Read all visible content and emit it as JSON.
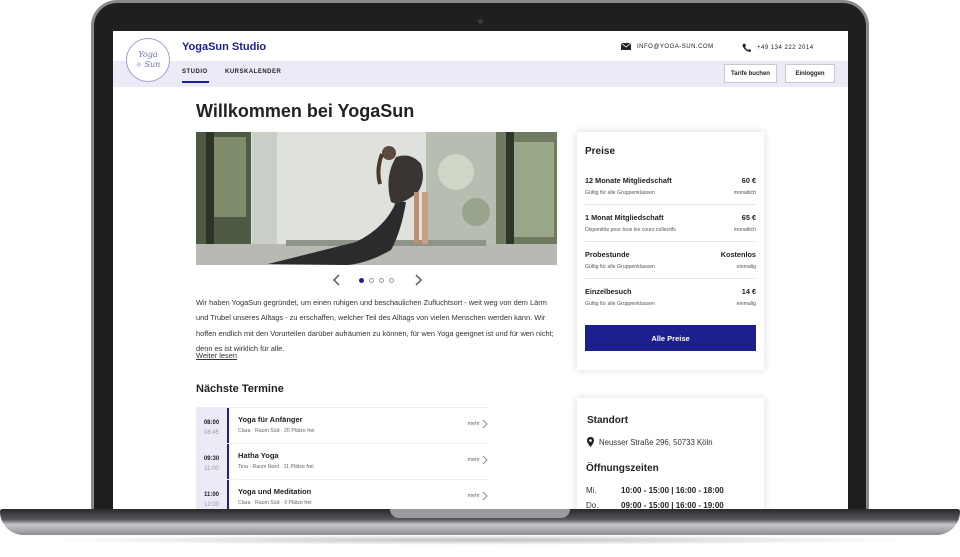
{
  "header": {
    "logo_text_line1": "Yoga",
    "logo_text_line2": "Sun",
    "brand": "YogaSun Studio",
    "email": "INFO@YOGA-SUN.COM",
    "phone": "+49 134 222 2014"
  },
  "nav": {
    "items": [
      {
        "label": "STUDIO",
        "active": true
      },
      {
        "label": "KURSKALENDER",
        "active": false
      }
    ],
    "buttons": {
      "book": "Tarife buchen",
      "login": "Einloggen"
    }
  },
  "main": {
    "title": "Willkommen bei  YogaSun",
    "carousel": {
      "slides": 4,
      "active": 1
    },
    "intro": "Wir haben YogaSun gegründet, um einen ruhigen und beschaulichen Zufluchtsort - weit weg von dem Lärm und Trubel unseres Alltags - zu erschaffen, welcher Teil des Alltags von vielen Menschen werden kann. Wir hoffen endlich mit den Vorurteilen darüber aufräumen zu können, für wen Yoga geeignet ist und für wen nicht; denn es ist wirklich für alle.",
    "read_more": "Weiter lesen"
  },
  "events": {
    "title": "Nächste Termine",
    "more_label": "mehr",
    "items": [
      {
        "start": "08:00",
        "end": "08:45",
        "name": "Yoga für Anfänger",
        "meta": "Clara · Raum Süd · 20 Plätze frei"
      },
      {
        "start": "09:30",
        "end": "11:00",
        "name": "Hatha Yoga",
        "meta": "Tina · Raum Nord · 11 Plätze frei"
      },
      {
        "start": "11:00",
        "end": "12:00",
        "name": "Yoga und Meditation",
        "meta": "Clara · Raum Süd · 9 Plätze frei"
      }
    ]
  },
  "prices": {
    "title": "Preise",
    "items": [
      {
        "name": "12 Monate Mitgliedschaft",
        "value": "60 €",
        "note": "Gültig für alle Gruppenklassen",
        "period": "monatlich"
      },
      {
        "name": "1 Monat Mitgliedschaft",
        "value": "65 €",
        "note": "Disponible pour tous les cours collectifs",
        "period": "monatlich"
      },
      {
        "name": "Probestunde",
        "value": "Kostenlos",
        "note": "Gültig für alle Gruppenklassen",
        "period": "einmalig"
      },
      {
        "name": "Einzelbesuch",
        "value": "14 €",
        "note": "Gültig für alle Gruppenklassen",
        "period": "einmalig"
      }
    ],
    "button": "Alle Preise"
  },
  "location": {
    "title": "Standort",
    "address": "Neusser Straße 296, 50733 Köln",
    "hours_title": "Öffnungszeiten",
    "hours": [
      {
        "day": "Mi.",
        "time": "10:00 - 15:00 | 16:00 - 18:00"
      },
      {
        "day": "Do.",
        "time": "09:00 - 15:00 | 16:00 - 19:00"
      }
    ]
  },
  "colors": {
    "accent": "#1c1f8f",
    "nav_bg": "#eceaf7"
  }
}
